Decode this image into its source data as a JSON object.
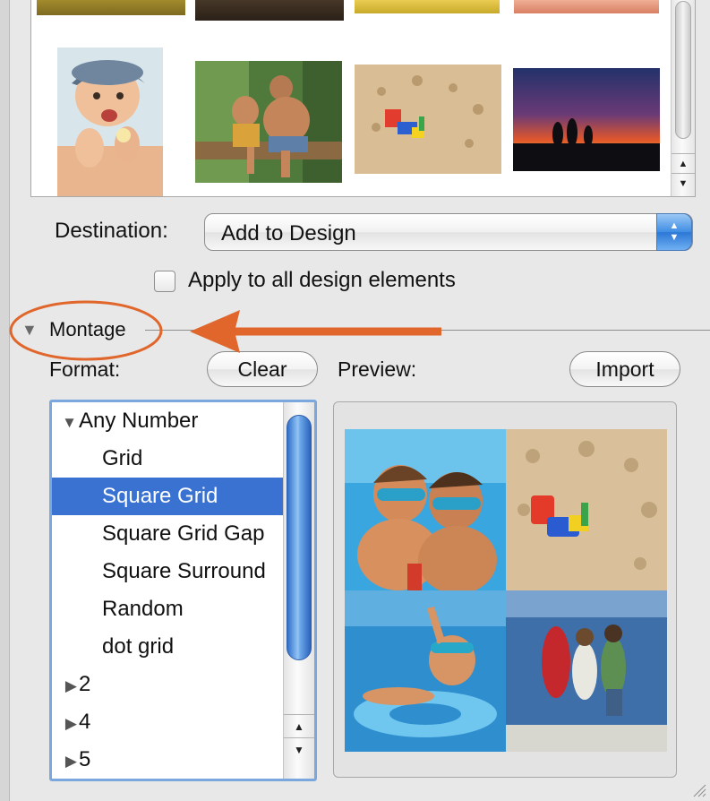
{
  "photos": {
    "row1": [
      "photo-1",
      "photo-2",
      "photo-3",
      "photo-4"
    ],
    "row2": [
      "toddler-photo",
      "father-son-fishing-photo",
      "sandcastle-toys-photo",
      "sunset-silhouettes-photo"
    ]
  },
  "destination": {
    "label": "Destination:",
    "value": "Add to Design"
  },
  "apply_all": {
    "label": "Apply to all design elements",
    "checked": false
  },
  "montage": {
    "title": "Montage",
    "format_label": "Format:",
    "clear_label": "Clear",
    "preview_label": "Preview:",
    "import_label": "Import"
  },
  "format_list": {
    "items": [
      {
        "label": "Any Number",
        "type": "group",
        "expanded": true
      },
      {
        "label": "Grid",
        "type": "item"
      },
      {
        "label": "Square Grid",
        "type": "item",
        "selected": true
      },
      {
        "label": "Square Grid Gap",
        "type": "item"
      },
      {
        "label": "Square Surround",
        "type": "item"
      },
      {
        "label": "Random",
        "type": "item"
      },
      {
        "label": "dot grid",
        "type": "item"
      },
      {
        "label": "2",
        "type": "group",
        "expanded": false
      },
      {
        "label": "4",
        "type": "group",
        "expanded": false
      },
      {
        "label": "5",
        "type": "group",
        "expanded": false
      }
    ]
  },
  "preview": {
    "images": [
      "boys-with-goggles-photo",
      "sandcastle-toys-photo",
      "boy-in-pool-ring-photo",
      "kids-on-dock-photo"
    ]
  },
  "colors": {
    "selection": "#3a72d1",
    "annotation": "#e0662b",
    "focus_ring": "#7aa7dd"
  }
}
